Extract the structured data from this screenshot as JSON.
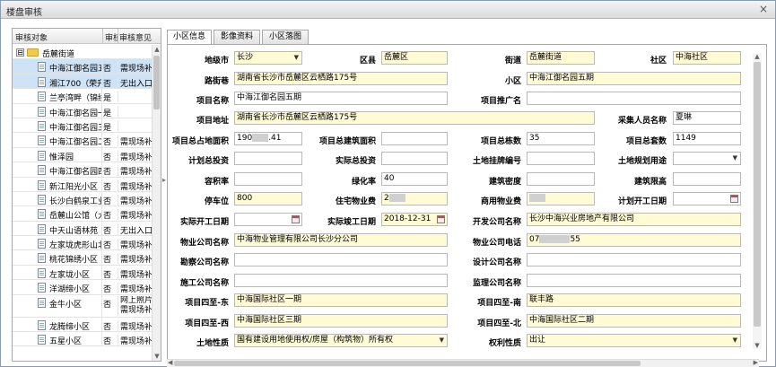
{
  "window": {
    "title": "楼盘审核",
    "close": "×"
  },
  "tree": {
    "headers": [
      "审核对象",
      "审核",
      "审核意见"
    ],
    "root": {
      "toggle": "⊟",
      "label": "岳麓街道"
    },
    "rows": [
      {
        "label": "中海江御名园五",
        "status": "否",
        "opinion": "需现场补",
        "selected": true
      },
      {
        "label": "湘江700（荣升",
        "status": "否",
        "opinion": "无出入口",
        "selected": true
      },
      {
        "label": "兰亭湾畔（锦绣",
        "status": "是",
        "opinion": ""
      },
      {
        "label": "中海江御名园一",
        "status": "是",
        "opinion": ""
      },
      {
        "label": "中海江御名园三",
        "status": "是",
        "opinion": ""
      },
      {
        "label": "中海江御名园二",
        "status": "否",
        "opinion": "需现场补"
      },
      {
        "label": "惟泽园",
        "status": "否",
        "opinion": "需现场补"
      },
      {
        "label": "中海江御名园四",
        "status": "否",
        "opinion": "需现场补"
      },
      {
        "label": "新江阳光小区",
        "status": "否",
        "opinion": "需现场补"
      },
      {
        "label": "长沙白鹤泉工业",
        "status": "否",
        "opinion": "需现场补"
      },
      {
        "label": "岳麓山公馆（大",
        "status": "否",
        "opinion": "需现场补"
      },
      {
        "label": "中天山语林苑",
        "status": "否",
        "opinion": "无出入口"
      },
      {
        "label": "左家垅虎形山北",
        "status": "否",
        "opinion": "需现场补"
      },
      {
        "label": "桃花锦绣小区",
        "status": "否",
        "opinion": "需现场补"
      },
      {
        "label": "左家垅小区",
        "status": "否",
        "opinion": "需现场补"
      },
      {
        "label": "洋湖缔小区",
        "status": "否",
        "opinion": "需现场补"
      },
      {
        "label": "金牛小区",
        "status": "否",
        "opinion": "网上照片 需现场补",
        "tall": true
      },
      {
        "label": "龙腾缔小区",
        "status": "否",
        "opinion": "需现场补"
      },
      {
        "label": "五星小区",
        "status": "否",
        "opinion": "需现场补"
      }
    ]
  },
  "tabs": [
    "小区信息",
    "影像资料",
    "小区落图"
  ],
  "form": {
    "city_label": "地级市",
    "city_value": "长沙",
    "county_label": "区县",
    "county_value": "岳麓区",
    "street_label": "街道",
    "street_value": "岳麓街道",
    "community_label": "社区",
    "community_value": "中海社区",
    "road_label": "路街巷",
    "road_value": "湖南省长沙市岳麓区云栖路175号",
    "estate_label": "小区",
    "estate_value": "中海江御名园五期",
    "project_name_label": "项目名称",
    "project_name_value": "中海江御名园五期",
    "promo_name_label": "项目推广名",
    "promo_name_value": "",
    "project_addr_label": "项目地址",
    "project_addr_value": "湖南省长沙市岳麓区云栖路175号",
    "collector_label": "采集人员名称",
    "collector_value": "夏琳",
    "land_area_label": "项目总占地面积",
    "land_area_prefix": "190",
    "land_area_suffix": ".41",
    "build_area_label": "项目总建筑面积",
    "build_area_value": "",
    "buildings_label": "项目总栋数",
    "buildings_value": "35",
    "units_label": "项目总套数",
    "units_value": "1149",
    "plan_invest_label": "计划总投资",
    "plan_invest_value": "",
    "actual_invest_label": "实际总投资",
    "actual_invest_value": "",
    "land_cert_label": "土地挂牌编号",
    "land_cert_value": "",
    "land_use_label": "土地规划用途",
    "land_use_value": "",
    "far_label": "容积率",
    "far_value": "",
    "green_label": "绿化率",
    "green_value": "40",
    "density_label": "建筑密度",
    "density_value": "",
    "height_label": "建筑限高",
    "height_value": "",
    "parking_label": "停车位",
    "parking_value": "800",
    "res_fee_label": "住宅物业费",
    "res_fee_value": "2",
    "com_fee_label": "商用物业费",
    "com_fee_value": "",
    "plan_start_label": "计划开工日期",
    "plan_start_value": "",
    "act_start_label": "实际开工日期",
    "act_start_value": "",
    "act_end_label": "实际竣工日期",
    "act_end_value": "2018-12-31",
    "developer_label": "开发公司名称",
    "developer_value": "长沙中海兴业房地产有限公司",
    "pm_label": "物业公司名称",
    "pm_value": "中海物业管理有限公司长沙分公司",
    "pm_phone_label": "物业公司电话",
    "pm_phone_prefix": "07",
    "pm_phone_suffix": "55",
    "survey_label": "勘察公司名称",
    "survey_value": "",
    "design_label": "设计公司名称",
    "design_value": "",
    "construct_label": "施工公司名称",
    "construct_value": "",
    "supervise_label": "监理公司名称",
    "supervise_value": "",
    "east_label": "项目四至-东",
    "east_value": "中海国际社区一期",
    "south_label": "项目四至-南",
    "south_value": "联丰路",
    "west_label": "项目四至-西",
    "west_value": "中海国际社区三期",
    "north_label": "项目四至-北",
    "north_value": "中海国际社区二期",
    "land_nature_label": "土地性质",
    "land_nature_value": "国有建设用地使用权/房屋（构筑物）所有权",
    "right_nature_label": "权利性质",
    "right_nature_value": "出让"
  }
}
